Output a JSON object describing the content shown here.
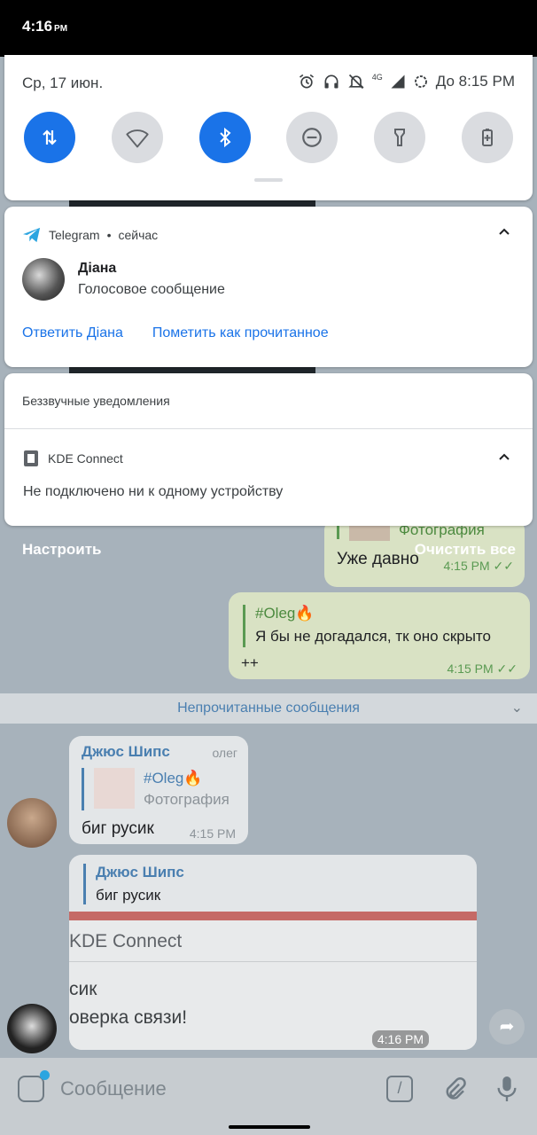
{
  "status_bar": {
    "time": "4:16",
    "ampm": "PM"
  },
  "quick_settings": {
    "date": "Ср, 17 июн.",
    "battery_label": "До 8:15 PM",
    "network": "4G",
    "tiles": [
      {
        "name": "mobile-data",
        "icon": "data-arrows-icon",
        "on": true
      },
      {
        "name": "wifi",
        "icon": "wifi-icon",
        "on": false
      },
      {
        "name": "bluetooth",
        "icon": "bluetooth-icon",
        "on": true
      },
      {
        "name": "do-not-disturb",
        "icon": "dnd-icon",
        "on": false
      },
      {
        "name": "flashlight",
        "icon": "flashlight-icon",
        "on": false
      },
      {
        "name": "battery-saver",
        "icon": "battery-saver-icon",
        "on": false
      }
    ]
  },
  "telegram_notification": {
    "app": "Telegram",
    "separator": "•",
    "when": "сейчас",
    "title": "Діана",
    "text": "Голосовое сообщение",
    "action_reply": "Ответить Діана",
    "action_mark_read": "Пометить как прочитанное"
  },
  "silent_notifications": {
    "section_title": "Беззвучные уведомления",
    "app": "KDE Connect",
    "text": "Не подключено ни к одному устройству"
  },
  "shade_buttons": {
    "manage": "Настроить",
    "clear_all": "Очистить все"
  },
  "chat": {
    "msg1_caption": "Фотография",
    "msg1_text": "Уже давно",
    "msg1_time": "4:15 PM",
    "msg2_tag": "#Oleg🔥",
    "msg2_quote": "Я бы не догадался, тк оно скрыто",
    "msg2_text": "++",
    "msg2_time": "4:15 PM",
    "unread_label": "Непрочитанные сообщения",
    "msg3_sender": "Джюс Шипс",
    "msg3_badge": "олег",
    "msg3_tag": "#Oleg🔥",
    "msg3_caption": "Фотография",
    "msg3_text": "биг русик",
    "msg3_time": "4:15 PM",
    "msg4_reply_sender": "Джюс Шипс",
    "msg4_reply_text": "биг русик",
    "msg4_shot_title": "KDE Connect",
    "msg4_shot_line1": "сик",
    "msg4_shot_line2": "оверка связи!",
    "msg4_time": "4:16 PM",
    "input_placeholder": "Сообщение"
  },
  "colors": {
    "accent": "#1a73e8",
    "telegram": "#2ca5e0"
  }
}
